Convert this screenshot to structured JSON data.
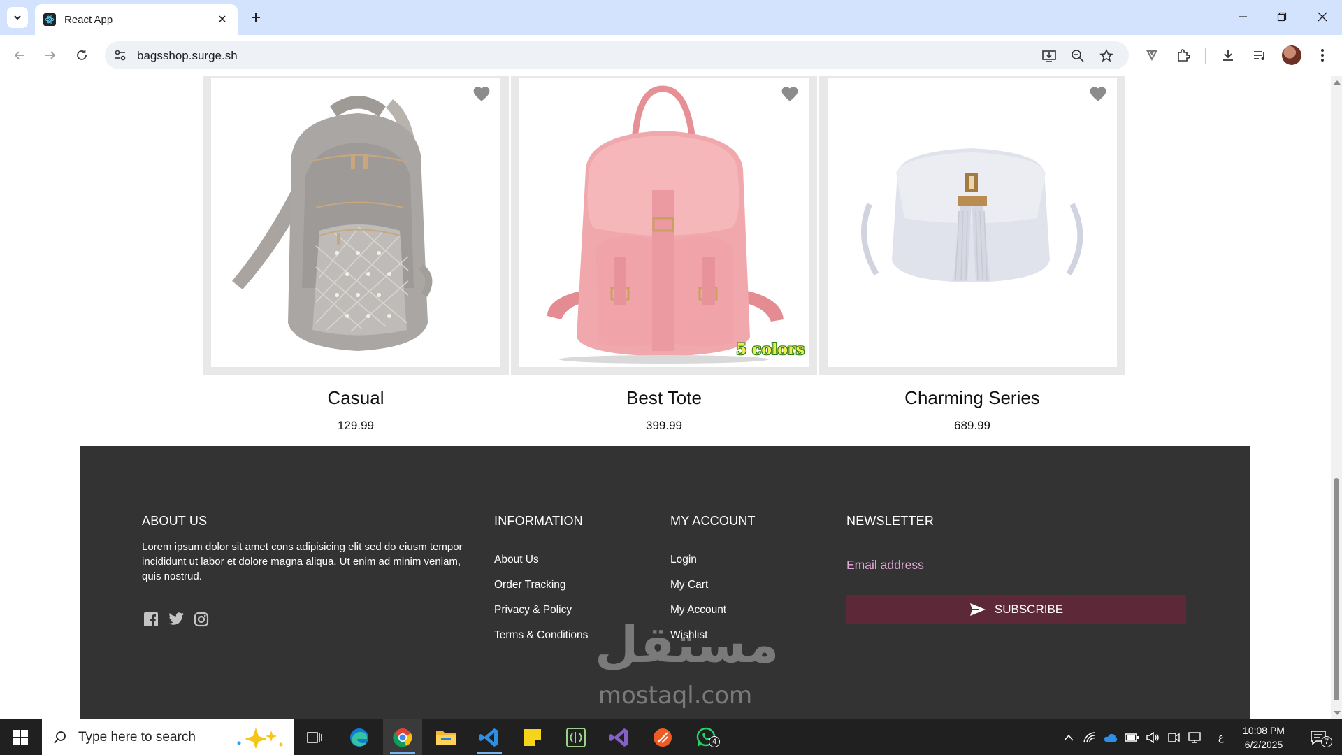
{
  "browser": {
    "tab_title": "React App",
    "url": "bagsshop.surge.sh"
  },
  "products": [
    {
      "name": "Casual",
      "price": "129.99"
    },
    {
      "name": "Best Tote",
      "price": "399.99",
      "badge": "5 colors"
    },
    {
      "name": "Charming Series",
      "price": "689.99"
    }
  ],
  "footer": {
    "about": {
      "title": "ABOUT US",
      "text": "Lorem ipsum dolor sit amet cons adipisicing elit sed do eiusm tempor incididunt ut labor et dolore magna aliqua. Ut enim ad minim veniam, quis nostrud."
    },
    "information": {
      "title": "INFORMATION",
      "links": [
        "About Us",
        "Order Tracking",
        "Privacy & Policy",
        "Terms & Conditions"
      ]
    },
    "account": {
      "title": "MY ACCOUNT",
      "links": [
        "Login",
        "My Cart",
        "My Account",
        "Wishlist"
      ]
    },
    "newsletter": {
      "title": "NEWSLETTER",
      "placeholder": "Email address",
      "button": "SUBSCRIBE"
    },
    "watermark_text": "mostaql.com",
    "watermark_arabic": "مستقل"
  },
  "taskbar": {
    "search_placeholder": "Type here to search",
    "whatsapp_badge": "4",
    "notifications": "7",
    "lang": "ع",
    "time": "10:08 PM",
    "date": "6/2/2025"
  },
  "colors": {
    "footer_bg": "#333333",
    "subscribe_bg": "#5d2838",
    "placeholder": "#e3a8d9",
    "tabbar": "#d3e3fd"
  }
}
